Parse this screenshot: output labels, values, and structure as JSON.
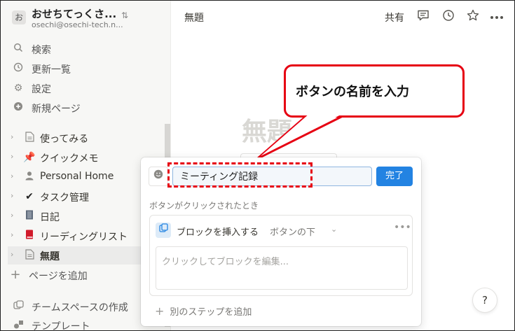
{
  "sidebar": {
    "workspace": {
      "avatar": "お",
      "name": "おせちてっくさ...",
      "email": "osechi@osechi-tech.n...",
      "switch_icon": "chevron-updown"
    },
    "nav": [
      {
        "label": "検索",
        "icon": "search-icon"
      },
      {
        "label": "更新一覧",
        "icon": "clock-icon"
      },
      {
        "label": "設定",
        "icon": "gear-icon"
      },
      {
        "label": "新規ページ",
        "icon": "plus-circle-icon"
      }
    ],
    "pages": [
      {
        "label": "使ってみる",
        "icon": "page-icon"
      },
      {
        "label": "クイックメモ",
        "icon": "pin-icon"
      },
      {
        "label": "Personal Home",
        "icon": "person-icon"
      },
      {
        "label": "タスク管理",
        "icon": "check-icon"
      },
      {
        "label": "日記",
        "icon": "notebook-icon"
      },
      {
        "label": "リーディングリスト",
        "icon": "book-icon"
      },
      {
        "label": "無題",
        "icon": "page-icon"
      }
    ],
    "add_page": "ページを追加",
    "teamspace": "チームスペースの作成",
    "templates": "テンプレート"
  },
  "topbar": {
    "title": "無題",
    "share": "共有"
  },
  "page": {
    "title": "無題"
  },
  "callout": {
    "text": "ボタンの名前を入力",
    "border_color": "#e60012"
  },
  "popup": {
    "name_value": "ミーティング記録",
    "done": "完了",
    "trigger_label": "ボタンがクリックされたとき",
    "step": {
      "action": "ブロックを挿入する",
      "position": "ボタンの下",
      "editor_placeholder": "クリックしてブロックを編集..."
    },
    "add_step": "別のステップを追加"
  },
  "help": "?",
  "accent": "#2383e2"
}
